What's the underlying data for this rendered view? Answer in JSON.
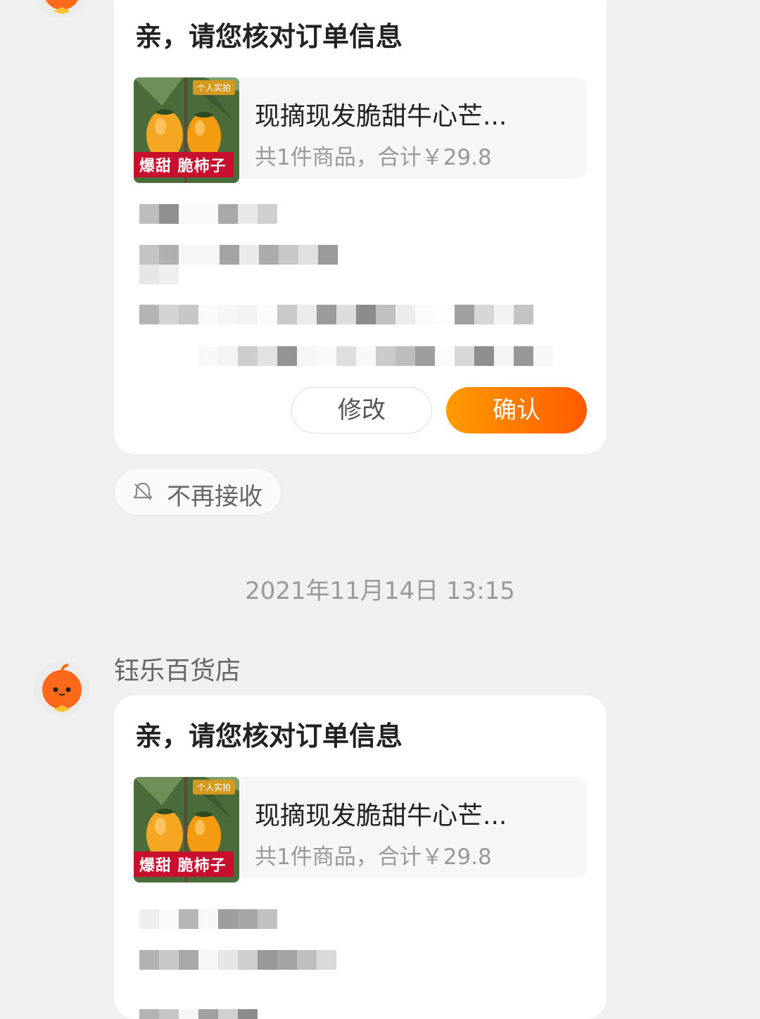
{
  "colors": {
    "page_bg": "#f0f0f0",
    "accent_orange": "#ff6a00",
    "card_bg": "#ffffff",
    "muted_text": "#999999"
  },
  "messages": [
    {
      "card_title": "亲，请您核对订单信息",
      "product": {
        "thumb_badge": "个人实拍",
        "thumb_label": "爆甜 脆柿子",
        "name": "现摘现发脆甜牛心芒...",
        "summary": "共1件商品，合计￥29.8"
      },
      "actions": {
        "modify": "修改",
        "confirm": "确认"
      }
    },
    {
      "card_title": "亲，请您核对订单信息",
      "product": {
        "thumb_badge": "个人实拍",
        "thumb_label": "爆甜 脆柿子",
        "name": "现摘现发脆甜牛心芒...",
        "summary": "共1件商品，合计￥29.8"
      }
    }
  ],
  "unsubscribe_label": "不再接收",
  "timestamp": "2021年11月14日 13:15",
  "shop_name": "钰乐百货店",
  "icons": {
    "avatar": "orange-mascot-avatar-icon",
    "unsubscribe": "bell-off-icon"
  }
}
